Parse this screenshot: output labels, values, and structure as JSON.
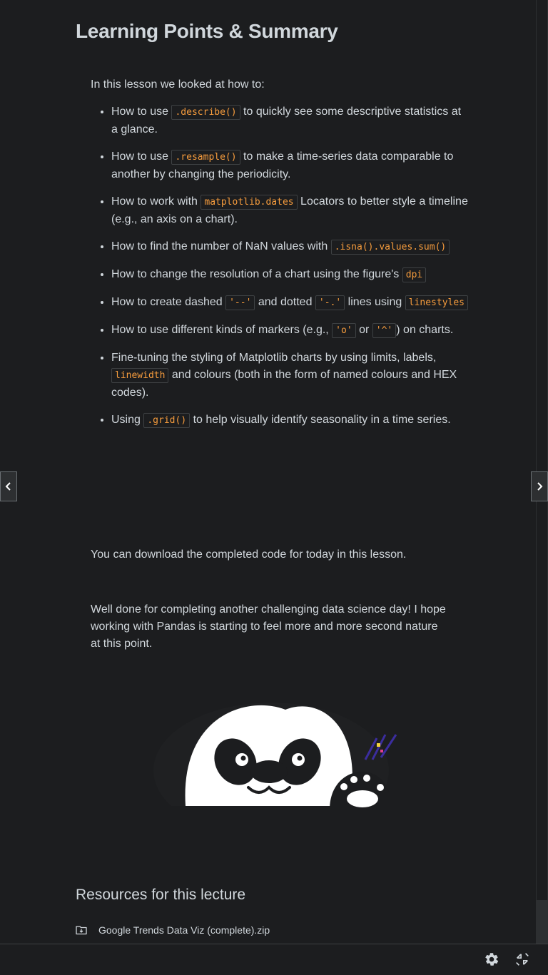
{
  "page": {
    "title": "Learning Points & Summary",
    "intro": "In this lesson we looked at how to:"
  },
  "points": [
    {
      "pre": "How to use ",
      "code": ".describe()",
      "post": " to quickly see some descriptive statistics at a glance."
    },
    {
      "pre": "How to use ",
      "code": ".resample()",
      "post": " to make a time-series data comparable to another by changing the periodicity."
    },
    {
      "pre": "How to work with ",
      "code": "matplotlib.dates",
      "post": " Locators to better style a timeline (e.g., an axis on a chart)."
    },
    {
      "pre": "How to find the number of NaN values with ",
      "code": ".isna().values.sum()",
      "post": ""
    },
    {
      "pre": "How to change the resolution of a chart using the figure's ",
      "code": "dpi",
      "post": ""
    },
    {
      "pre": "How to create dashed ",
      "code": "'--'",
      "mid": " and dotted ",
      "code2": "'-.'",
      "mid2": " lines using ",
      "code3": "linestyles"
    },
    {
      "pre": "How to use different kinds of markers (e.g., ",
      "code": "'o'",
      "mid": " or ",
      "code2": "'^'",
      "post": ") on charts."
    },
    {
      "pre": "Fine-tuning the styling of Matplotlib charts by using limits, labels, ",
      "code": "linewidth",
      "post": " and colours (both in the form of named colours and HEX codes)."
    },
    {
      "pre": "Using ",
      "code": ".grid()",
      "post": " to help visually identify seasonality in a time series."
    }
  ],
  "download_text": "You can download the completed code for today in this lesson.",
  "closing_text": "Well done for completing another challenging data science day! I hope working with Pandas is starting to feel more and more second nature at this point.",
  "resources": {
    "heading": "Resources for this lecture",
    "items": [
      {
        "name": "Google Trends Data Viz (complete).zip",
        "icon": "download-folder-icon"
      }
    ]
  },
  "icons": {
    "settings": "gear-icon",
    "fullscreen": "exit-fullscreen-icon",
    "prev": "chevron-left-icon",
    "next": "chevron-right-icon"
  },
  "colors": {
    "background": "#1c1d1f",
    "text": "#d1d7dc",
    "code": "#f69c3d",
    "code_border": "#3e4143"
  }
}
